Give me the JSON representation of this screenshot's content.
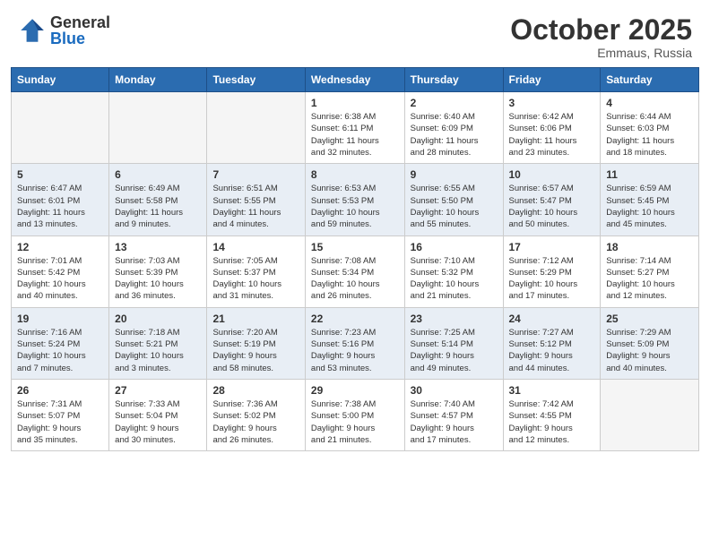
{
  "header": {
    "logo_general": "General",
    "logo_blue": "Blue",
    "month": "October 2025",
    "location": "Emmaus, Russia"
  },
  "weekdays": [
    "Sunday",
    "Monday",
    "Tuesday",
    "Wednesday",
    "Thursday",
    "Friday",
    "Saturday"
  ],
  "weeks": [
    [
      {
        "day": "",
        "info": ""
      },
      {
        "day": "",
        "info": ""
      },
      {
        "day": "",
        "info": ""
      },
      {
        "day": "1",
        "info": "Sunrise: 6:38 AM\nSunset: 6:11 PM\nDaylight: 11 hours\nand 32 minutes."
      },
      {
        "day": "2",
        "info": "Sunrise: 6:40 AM\nSunset: 6:09 PM\nDaylight: 11 hours\nand 28 minutes."
      },
      {
        "day": "3",
        "info": "Sunrise: 6:42 AM\nSunset: 6:06 PM\nDaylight: 11 hours\nand 23 minutes."
      },
      {
        "day": "4",
        "info": "Sunrise: 6:44 AM\nSunset: 6:03 PM\nDaylight: 11 hours\nand 18 minutes."
      }
    ],
    [
      {
        "day": "5",
        "info": "Sunrise: 6:47 AM\nSunset: 6:01 PM\nDaylight: 11 hours\nand 13 minutes."
      },
      {
        "day": "6",
        "info": "Sunrise: 6:49 AM\nSunset: 5:58 PM\nDaylight: 11 hours\nand 9 minutes."
      },
      {
        "day": "7",
        "info": "Sunrise: 6:51 AM\nSunset: 5:55 PM\nDaylight: 11 hours\nand 4 minutes."
      },
      {
        "day": "8",
        "info": "Sunrise: 6:53 AM\nSunset: 5:53 PM\nDaylight: 10 hours\nand 59 minutes."
      },
      {
        "day": "9",
        "info": "Sunrise: 6:55 AM\nSunset: 5:50 PM\nDaylight: 10 hours\nand 55 minutes."
      },
      {
        "day": "10",
        "info": "Sunrise: 6:57 AM\nSunset: 5:47 PM\nDaylight: 10 hours\nand 50 minutes."
      },
      {
        "day": "11",
        "info": "Sunrise: 6:59 AM\nSunset: 5:45 PM\nDaylight: 10 hours\nand 45 minutes."
      }
    ],
    [
      {
        "day": "12",
        "info": "Sunrise: 7:01 AM\nSunset: 5:42 PM\nDaylight: 10 hours\nand 40 minutes."
      },
      {
        "day": "13",
        "info": "Sunrise: 7:03 AM\nSunset: 5:39 PM\nDaylight: 10 hours\nand 36 minutes."
      },
      {
        "day": "14",
        "info": "Sunrise: 7:05 AM\nSunset: 5:37 PM\nDaylight: 10 hours\nand 31 minutes."
      },
      {
        "day": "15",
        "info": "Sunrise: 7:08 AM\nSunset: 5:34 PM\nDaylight: 10 hours\nand 26 minutes."
      },
      {
        "day": "16",
        "info": "Sunrise: 7:10 AM\nSunset: 5:32 PM\nDaylight: 10 hours\nand 21 minutes."
      },
      {
        "day": "17",
        "info": "Sunrise: 7:12 AM\nSunset: 5:29 PM\nDaylight: 10 hours\nand 17 minutes."
      },
      {
        "day": "18",
        "info": "Sunrise: 7:14 AM\nSunset: 5:27 PM\nDaylight: 10 hours\nand 12 minutes."
      }
    ],
    [
      {
        "day": "19",
        "info": "Sunrise: 7:16 AM\nSunset: 5:24 PM\nDaylight: 10 hours\nand 7 minutes."
      },
      {
        "day": "20",
        "info": "Sunrise: 7:18 AM\nSunset: 5:21 PM\nDaylight: 10 hours\nand 3 minutes."
      },
      {
        "day": "21",
        "info": "Sunrise: 7:20 AM\nSunset: 5:19 PM\nDaylight: 9 hours\nand 58 minutes."
      },
      {
        "day": "22",
        "info": "Sunrise: 7:23 AM\nSunset: 5:16 PM\nDaylight: 9 hours\nand 53 minutes."
      },
      {
        "day": "23",
        "info": "Sunrise: 7:25 AM\nSunset: 5:14 PM\nDaylight: 9 hours\nand 49 minutes."
      },
      {
        "day": "24",
        "info": "Sunrise: 7:27 AM\nSunset: 5:12 PM\nDaylight: 9 hours\nand 44 minutes."
      },
      {
        "day": "25",
        "info": "Sunrise: 7:29 AM\nSunset: 5:09 PM\nDaylight: 9 hours\nand 40 minutes."
      }
    ],
    [
      {
        "day": "26",
        "info": "Sunrise: 7:31 AM\nSunset: 5:07 PM\nDaylight: 9 hours\nand 35 minutes."
      },
      {
        "day": "27",
        "info": "Sunrise: 7:33 AM\nSunset: 5:04 PM\nDaylight: 9 hours\nand 30 minutes."
      },
      {
        "day": "28",
        "info": "Sunrise: 7:36 AM\nSunset: 5:02 PM\nDaylight: 9 hours\nand 26 minutes."
      },
      {
        "day": "29",
        "info": "Sunrise: 7:38 AM\nSunset: 5:00 PM\nDaylight: 9 hours\nand 21 minutes."
      },
      {
        "day": "30",
        "info": "Sunrise: 7:40 AM\nSunset: 4:57 PM\nDaylight: 9 hours\nand 17 minutes."
      },
      {
        "day": "31",
        "info": "Sunrise: 7:42 AM\nSunset: 4:55 PM\nDaylight: 9 hours\nand 12 minutes."
      },
      {
        "day": "",
        "info": ""
      }
    ]
  ]
}
